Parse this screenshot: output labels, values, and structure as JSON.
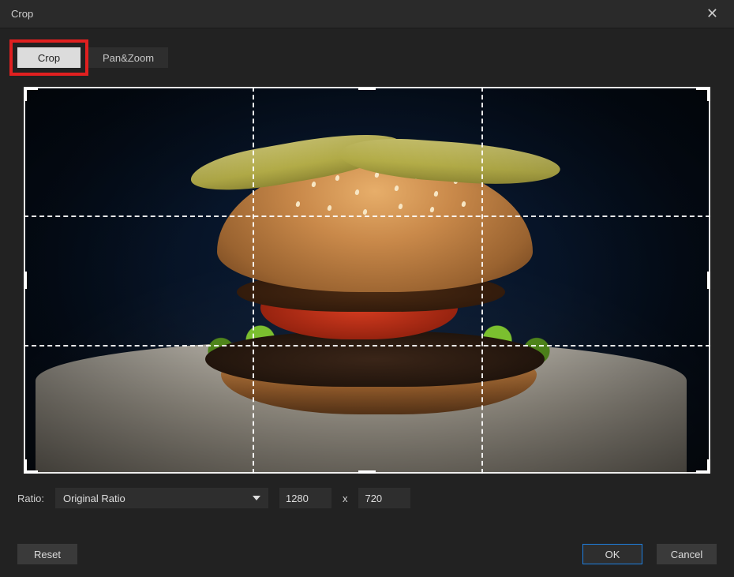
{
  "window": {
    "title": "Crop"
  },
  "tabs": {
    "crop_label": "Crop",
    "panzoom_label": "Pan&Zoom",
    "active": "crop"
  },
  "ratio": {
    "label": "Ratio:",
    "selected": "Original Ratio",
    "width": "1280",
    "separator": "x",
    "height": "720"
  },
  "footer": {
    "reset_label": "Reset",
    "ok_label": "OK",
    "cancel_label": "Cancel"
  },
  "icons": {
    "close": "✕"
  }
}
